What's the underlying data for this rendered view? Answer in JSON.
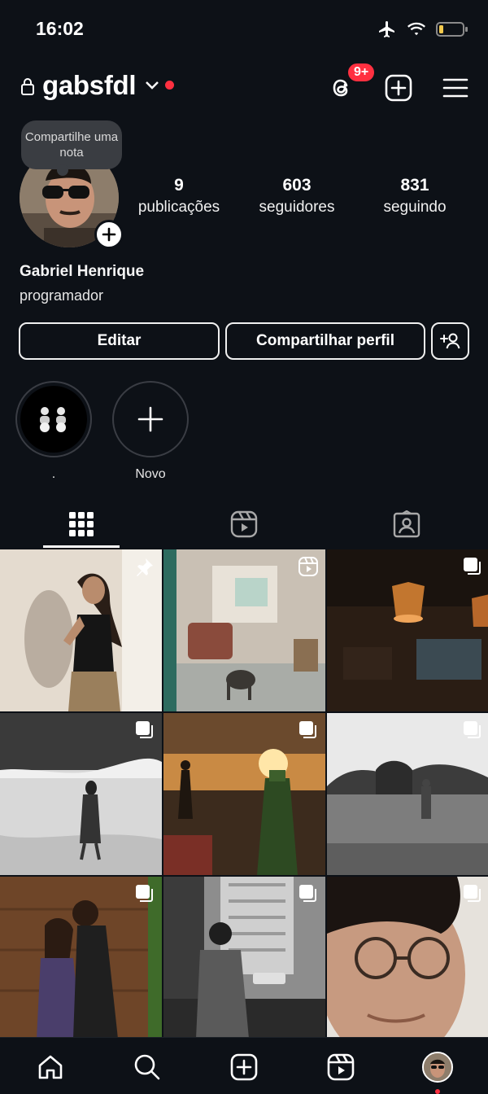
{
  "status_bar": {
    "time": "16:02"
  },
  "header": {
    "username": "gabsfdl",
    "notifications_badge": "9+"
  },
  "profile": {
    "note_placeholder": "Compartilhe uma nota",
    "stats": [
      {
        "value": "9",
        "label": "publicações"
      },
      {
        "value": "603",
        "label": "seguidores"
      },
      {
        "value": "831",
        "label": "seguindo"
      }
    ],
    "full_name": "Gabriel Henrique",
    "bio": "programador"
  },
  "actions": {
    "edit": "Editar",
    "share": "Compartilhar perfil"
  },
  "highlights": [
    {
      "label": "."
    },
    {
      "label": "Novo"
    }
  ],
  "tabs": [
    "posts-grid",
    "reels",
    "tagged"
  ],
  "posts": [
    {
      "badge": "pin-icon"
    },
    {
      "badge": "reel-icon"
    },
    {
      "badge": "carousel-icon"
    },
    {
      "badge": "carousel-icon"
    },
    {
      "badge": "carousel-icon"
    },
    {
      "badge": "carousel-icon"
    },
    {
      "badge": "carousel-icon"
    },
    {
      "badge": "carousel-icon"
    },
    {
      "badge": "carousel-icon"
    }
  ],
  "colors": {
    "background": "#0d1117",
    "badge_red": "#ff3040",
    "text": "#f5f5f5"
  }
}
